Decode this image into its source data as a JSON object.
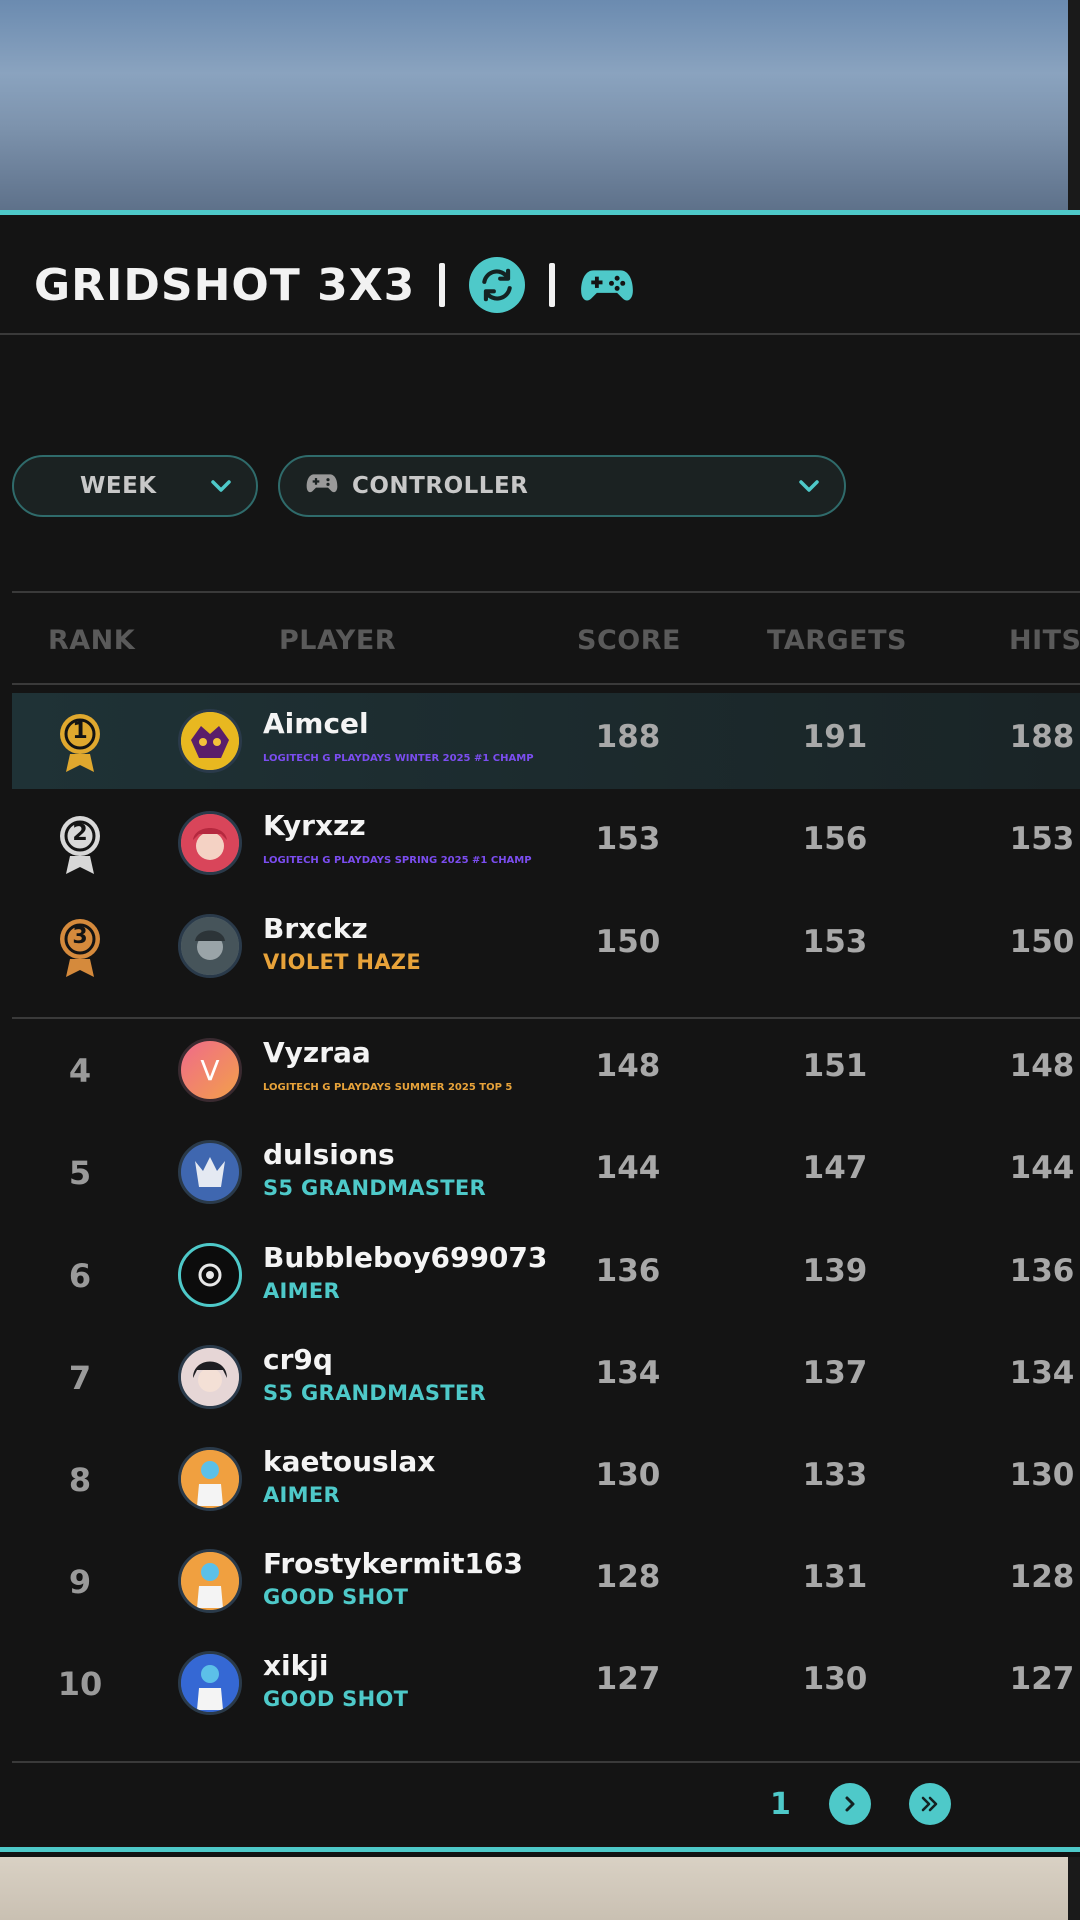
{
  "header": {
    "title": "GRIDSHOT 3X3",
    "accent_color": "#4ec9c9",
    "icons": [
      "refresh-icon",
      "gamepad-icon"
    ]
  },
  "filters": {
    "period": "WEEK",
    "input_type": "CONTROLLER"
  },
  "table": {
    "columns": {
      "rank": "RANK",
      "player": "PLAYER",
      "score": "SCORE",
      "targets": "TARGETS",
      "hits": "HITS"
    },
    "rows": [
      {
        "rank": "1",
        "name": "Aimcel",
        "tag": "LOGITECH G PLAYDAYS WINTER 2025 #1 CHAMP",
        "tag_color": "#7b4df0",
        "score": "188",
        "targets": "191",
        "hits": "188"
      },
      {
        "rank": "2",
        "name": "Kyrxzz",
        "tag": "LOGITECH G PLAYDAYS SPRING 2025 #1 CHAMP",
        "tag_color": "#7b4df0",
        "score": "153",
        "targets": "156",
        "hits": "153"
      },
      {
        "rank": "3",
        "name": "Brxckz",
        "tag": "VIOLET HAZE",
        "tag_color": "#e8a33a",
        "score": "150",
        "targets": "153",
        "hits": "150"
      },
      {
        "rank": "4",
        "name": "Vyzraa",
        "tag": "LOGITECH G PLAYDAYS SUMMER 2025 TOP 5",
        "tag_color": "#e8a33a",
        "score": "148",
        "targets": "151",
        "hits": "148"
      },
      {
        "rank": "5",
        "name": "dulsions",
        "tag": "S5 GRANDMASTER",
        "tag_color": "#4ec9c9",
        "score": "144",
        "targets": "147",
        "hits": "144"
      },
      {
        "rank": "6",
        "name": "Bubbleboy699073",
        "tag": "AIMER",
        "tag_color": "#4ec9c9",
        "score": "136",
        "targets": "139",
        "hits": "136"
      },
      {
        "rank": "7",
        "name": "cr9q",
        "tag": "S5 GRANDMASTER",
        "tag_color": "#4ec9c9",
        "score": "134",
        "targets": "137",
        "hits": "134"
      },
      {
        "rank": "8",
        "name": "kaetouslax",
        "tag": "AIMER",
        "tag_color": "#4ec9c9",
        "score": "130",
        "targets": "133",
        "hits": "130"
      },
      {
        "rank": "9",
        "name": "Frostykermit163",
        "tag": "GOOD SHOT",
        "tag_color": "#4ec9c9",
        "score": "128",
        "targets": "131",
        "hits": "128"
      },
      {
        "rank": "10",
        "name": "xikji",
        "tag": "GOOD SHOT",
        "tag_color": "#4ec9c9",
        "score": "127",
        "targets": "130",
        "hits": "127"
      }
    ]
  },
  "medal_colors": {
    "gold": "#e0a82e",
    "silver": "#d8d8d8",
    "bronze": "#d58a3c"
  },
  "pagination": {
    "current_page": "1"
  }
}
